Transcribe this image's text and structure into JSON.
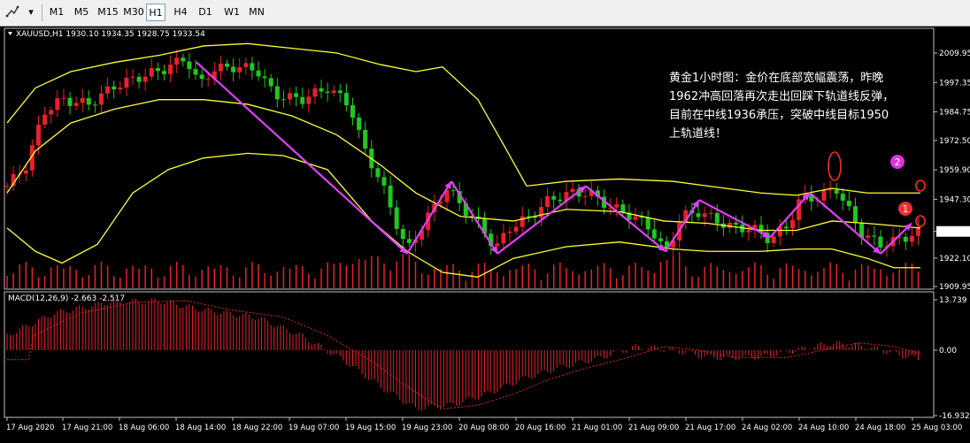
{
  "toolbar": {
    "timeframes": [
      "M1",
      "M5",
      "M15",
      "M30",
      "H1",
      "H4",
      "D1",
      "W1",
      "MN"
    ],
    "active": "H1"
  },
  "chart": {
    "symbol_info": "XAUUSD,H1  1930.10 1934.35 1928.75 1933.54",
    "macd_info": "MACD(12,26,9) -2.663 -2.517",
    "price_ticks": [
      "2009.95",
      "1997.35",
      "1984.75",
      "1972.50",
      "1959.90",
      "1947.30",
      "1933.54",
      "1922.10",
      "1909.95"
    ],
    "current_price": "1933.54",
    "macd_ticks": [
      "13.739",
      "0.00",
      "-16.932"
    ],
    "time_ticks": [
      "17 Aug 2020",
      "17 Aug 21:00",
      "18 Aug 06:00",
      "18 Aug 14:00",
      "18 Aug 22:00",
      "19 Aug 07:00",
      "19 Aug 15:00",
      "19 Aug 23:00",
      "20 Aug 08:00",
      "20 Aug 16:00",
      "21 Aug 01:00",
      "21 Aug 09:00",
      "21 Aug 17:00",
      "24 Aug 02:00",
      "24 Aug 10:00",
      "24 Aug 18:00",
      "25 Aug 03:00"
    ],
    "annotation": [
      "黄金1小时图：金价在底部宽幅震荡，昨晚",
      "1962冲高回落再次走出回踩下轨道线反弹，",
      "目前在中线1936承压，突破中线目标1950",
      "上轨道线！"
    ],
    "marker_1": "1",
    "marker_2": "2",
    "colors": {
      "up": "#e8202a",
      "down": "#1ec81e",
      "band": "#ffff33",
      "arrow": "#e040fb",
      "macd": "#e8202a",
      "annotation": "#ffff33"
    }
  }
}
